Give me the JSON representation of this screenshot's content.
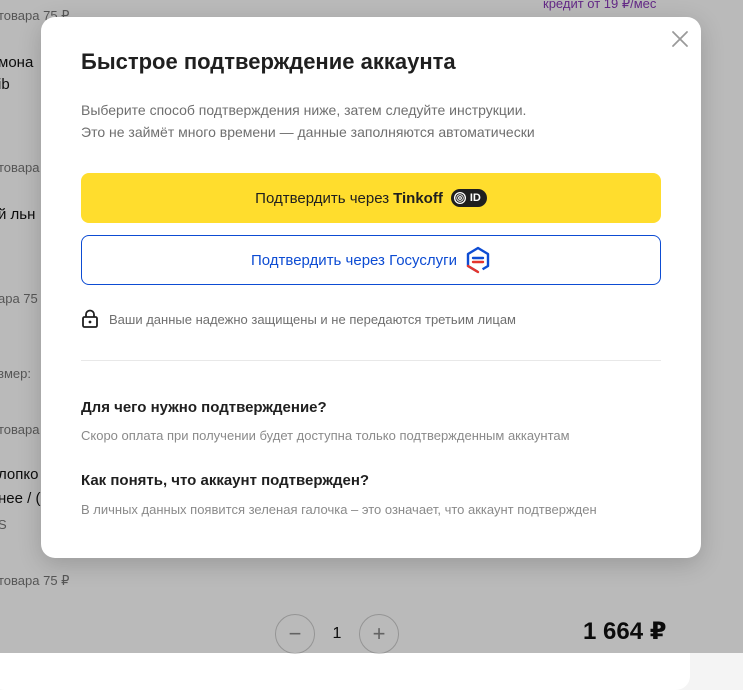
{
  "background": {
    "credit_text": "кредит от 19 ₽/мес",
    "fragments": [
      "товара 75 ₽",
      "мона",
      "ib",
      "товара",
      "й льн",
      "ара 75",
      "змер:",
      "товара",
      "лопко",
      "нее / (",
      "S",
      "товара 75 ₽"
    ],
    "quantity": "1",
    "minus": "−",
    "plus": "+",
    "price": "1 664 ₽"
  },
  "modal": {
    "title": "Быстрое подтверждение аккаунта",
    "subtitle_line1": "Выберите способ подтверждения ниже, затем следуйте инструкции.",
    "subtitle_line2": "Это не займёт много времени — данные заполняются автоматически",
    "tinkoff_button": {
      "prefix": "Подтвердить через",
      "brand": "Tinkoff",
      "badge": "ID",
      "color": "#ffdd2d"
    },
    "gosuslugi_button": {
      "label": "Подтвердить через Госуслуги",
      "color": "#0d4cd3"
    },
    "security_note": "Ваши данные надежно защищены и не передаются третьим лицам",
    "faq": [
      {
        "question": "Для чего нужно подтверждение?",
        "answer": "Скоро оплата при получении будет доступна только подтвержденным аккаунтам"
      },
      {
        "question": "Как понять, что аккаунт подтвержден?",
        "answer": "В личных данных появится зеленая галочка – это означает, что аккаунт подтвержден"
      }
    ],
    "icons": [
      "close-icon",
      "tinkoff-id-logo",
      "gosuslugi-logo",
      "lock-icon"
    ]
  }
}
